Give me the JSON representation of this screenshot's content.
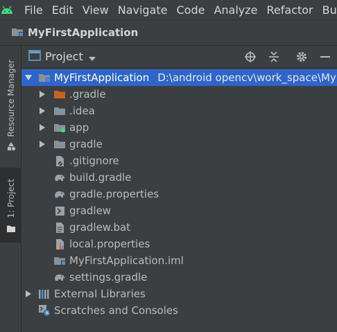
{
  "menu": {
    "items": [
      "File",
      "Edit",
      "View",
      "Navigate",
      "Code",
      "Analyze",
      "Refactor",
      "Bu"
    ]
  },
  "navbar": {
    "title": "MyFirstApplication"
  },
  "stripe": {
    "resource_manager": "Resource Manager",
    "project": "1: Project"
  },
  "panel": {
    "title": "Project"
  },
  "tree": {
    "root": {
      "label": "MyFirstApplication",
      "path": "D:\\android opencv\\work_space\\My"
    },
    "items": [
      {
        "label": ".gradle",
        "icon": "folder-orange-icon"
      },
      {
        "label": ".idea",
        "icon": "folder-icon"
      },
      {
        "label": "app",
        "icon": "module-folder-icon"
      },
      {
        "label": "gradle",
        "icon": "folder-icon"
      },
      {
        "label": ".gitignore",
        "icon": "gitignore-file-icon"
      },
      {
        "label": "build.gradle",
        "icon": "gradle-elephant-icon"
      },
      {
        "label": "gradle.properties",
        "icon": "gradle-elephant-icon"
      },
      {
        "label": "gradlew",
        "icon": "shell-script-icon"
      },
      {
        "label": "gradlew.bat",
        "icon": "text-file-icon"
      },
      {
        "label": "local.properties",
        "icon": "properties-file-icon"
      },
      {
        "label": "MyFirstApplication.iml",
        "icon": "iml-file-icon"
      },
      {
        "label": "settings.gradle",
        "icon": "gradle-elephant-icon"
      }
    ],
    "external_libraries": "External Libraries",
    "scratches": "Scratches and Consoles"
  },
  "colors": {
    "selection": "#2f65ca",
    "android_green": "#3ddc84",
    "folder_blue": "#87939a",
    "gradle_folder_orange": "#c7641e"
  }
}
